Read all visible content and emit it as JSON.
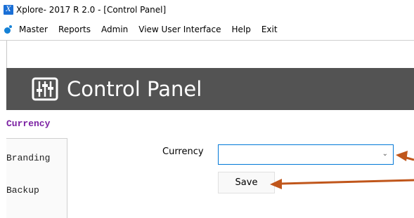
{
  "window": {
    "icon_letter": "X",
    "title": "Xplore- 2017 R 2.0  - [Control Panel]"
  },
  "menu": {
    "icon": "app-dot-icon",
    "items": [
      "Master",
      "Reports",
      "Admin",
      "View User Interface",
      "Help",
      "Exit"
    ]
  },
  "header": {
    "icon": "control-panel-sliders-icon",
    "title": "Control Panel"
  },
  "sidebar": {
    "active": "Currency",
    "items": [
      "Branding",
      "Backup"
    ]
  },
  "form": {
    "currency_label": "Currency",
    "currency_value": "",
    "save_label": "Save"
  },
  "colors": {
    "accent": "#7a1fa2",
    "header_bg": "#535353",
    "arrow": "#c0561b",
    "select_border": "#0078d7"
  }
}
